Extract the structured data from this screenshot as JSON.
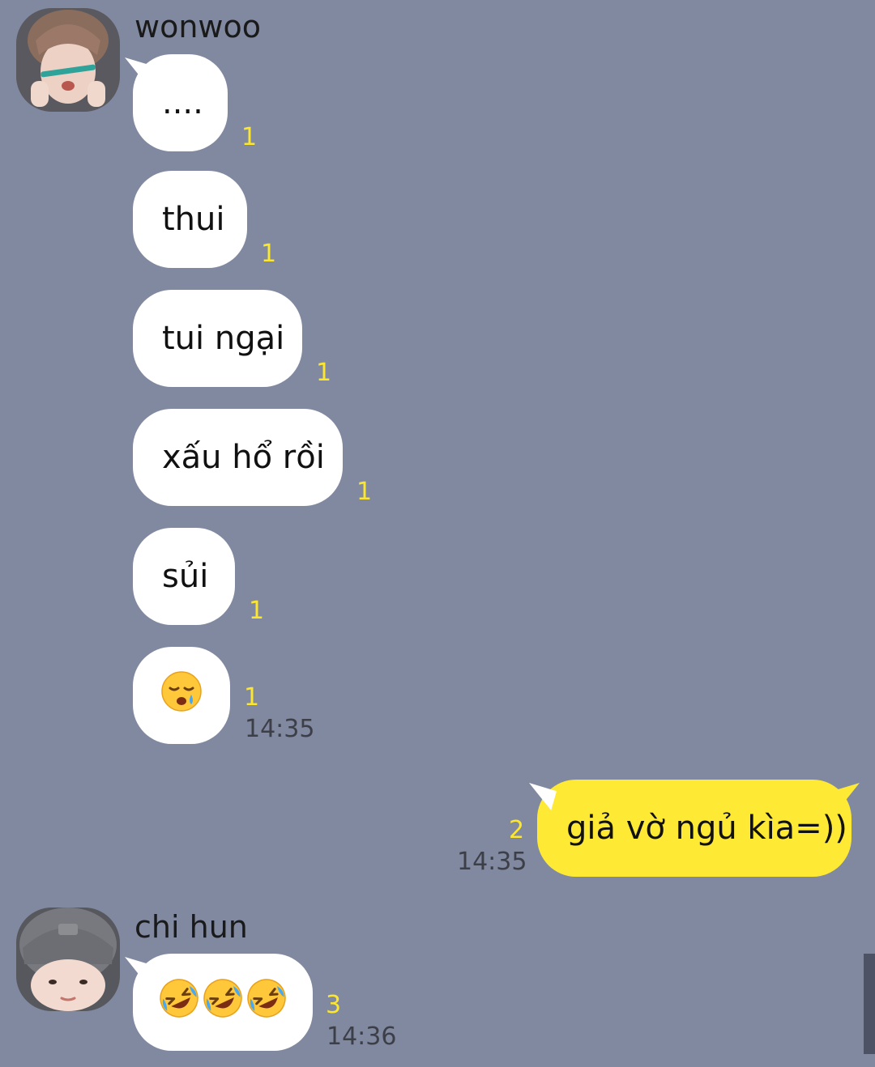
{
  "threads": {
    "wonwoo": {
      "name": "wonwoo",
      "messages": [
        {
          "text": "....",
          "unread": "1"
        },
        {
          "text": "thui",
          "unread": "1"
        },
        {
          "text": "tui ngại",
          "unread": "1"
        },
        {
          "text": "xấu hổ rồi",
          "unread": "1"
        },
        {
          "text": "sủi",
          "unread": "1"
        },
        {
          "emoji": "sleepy-face",
          "unread": "1",
          "time": "14:35"
        }
      ]
    },
    "me": {
      "messages": [
        {
          "text": "giả vờ ngủ kìa=))",
          "unread": "2",
          "time": "14:35"
        }
      ]
    },
    "chi_hun": {
      "name": "chi hun",
      "messages": [
        {
          "emoji": "rolling-on-floor-laughing x3",
          "unread": "3",
          "time": "14:36"
        }
      ]
    }
  },
  "colors": {
    "background": "#8089a0",
    "my_bubble": "#fee934",
    "their_bubble": "#ffffff",
    "unread": "#fde72e"
  }
}
